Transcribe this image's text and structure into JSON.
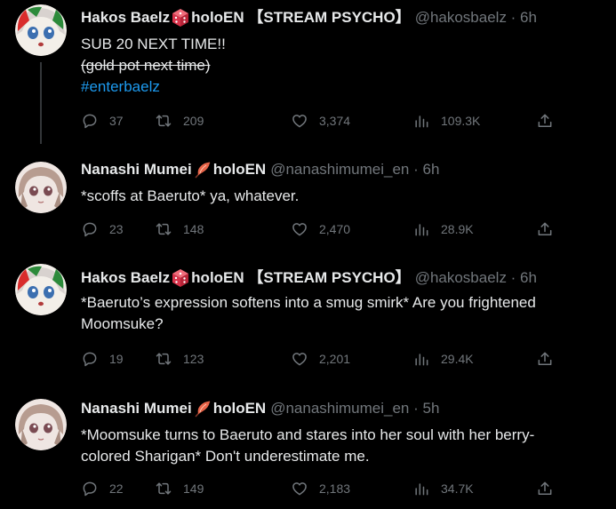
{
  "tweets": [
    {
      "name": "Hakos Baelz",
      "name_suffix": "holoEN 【STREAM PSYCHO】",
      "handle_time": "@hakosbaelz · 6h",
      "name_emoji": "dice-icon",
      "avatar": "baelz-avatar",
      "lines": [
        {
          "text": "SUB 20 NEXT TIME!!",
          "style": "normal"
        },
        {
          "text": "(gold pot next time)",
          "style": "strike"
        },
        {
          "text": "#enterbaelz",
          "style": "hashtag"
        }
      ],
      "replies": "37",
      "retweets": "209",
      "likes": "3,374",
      "views": "109.3K"
    },
    {
      "name": "Nanashi Mumei",
      "name_suffix": "holoEN",
      "handle_time": "@nanashimumei_en · 6h",
      "name_emoji": "feather-icon",
      "avatar": "mumei-avatar",
      "lines": [
        {
          "text": "*scoffs at Baeruto* ya, whatever.",
          "style": "normal"
        }
      ],
      "replies": "23",
      "retweets": "148",
      "likes": "2,470",
      "views": "28.9K"
    },
    {
      "name": "Hakos Baelz",
      "name_suffix": "holoEN 【STREAM PSYCHO】",
      "handle_time": "@hakosbaelz · 6h",
      "name_emoji": "dice-icon",
      "avatar": "baelz-avatar",
      "lines": [
        {
          "text": "*Baeruto’s expression softens into a smug smirk* Are you frightened",
          "style": "normal"
        },
        {
          "text": "Moomsuke?",
          "style": "normal"
        }
      ],
      "replies": "19",
      "retweets": "123",
      "likes": "2,201",
      "views": "29.4K"
    },
    {
      "name": "Nanashi Mumei",
      "name_suffix": "holoEN",
      "handle_time": "@nanashimumei_en · 5h",
      "name_emoji": "feather-icon",
      "avatar": "mumei-avatar",
      "lines": [
        {
          "text": "*Moomsuke turns to Baeruto and stares into her soul with her berry-",
          "style": "normal"
        },
        {
          "text": "colored Sharigan* Don't underestimate me.",
          "style": "normal"
        }
      ],
      "replies": "22",
      "retweets": "149",
      "likes": "2,183",
      "views": "34.7K"
    }
  ],
  "colors": {
    "background": "#000000",
    "text": "#e7e9ea",
    "muted": "#71767b",
    "link": "#1d9bf0",
    "thread_line": "#333639"
  }
}
